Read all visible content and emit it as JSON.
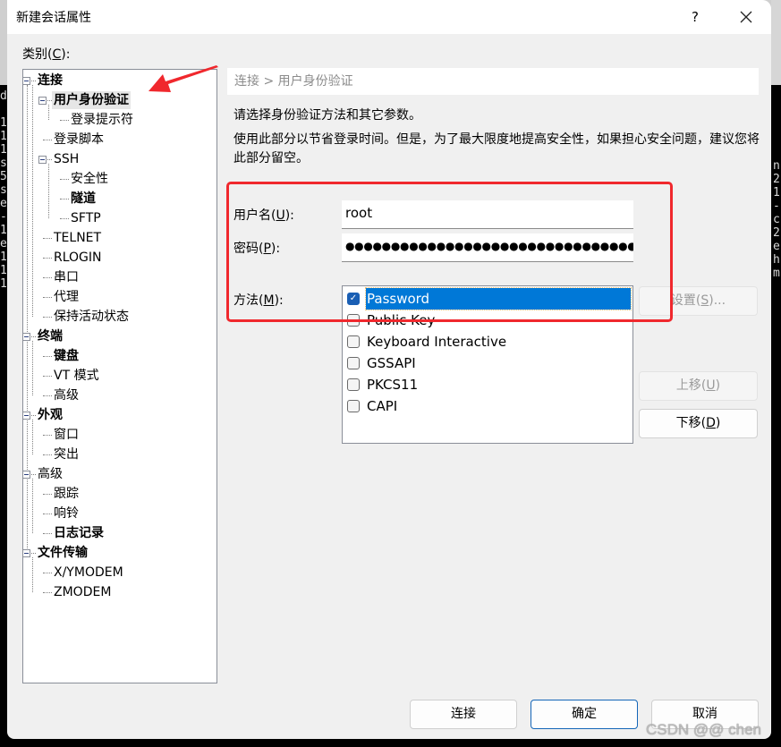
{
  "window": {
    "title": "新建会话属性",
    "help_label": "?",
    "close_label": "✕"
  },
  "background_terminal": {
    "left_chars": "d\n\n1\n1\n1\ns\n5\ns\ne\n-\n1\ne\n1\n1\n1",
    "right_chars": "n\n2\n1\n-\nc\n2\ne\nh\nm"
  },
  "category": {
    "label_prefix": "类别(",
    "label_accel": "C",
    "label_suffix": "):"
  },
  "tree": {
    "items": [
      {
        "label": "连接",
        "level": 0,
        "bold": true,
        "expandable": true
      },
      {
        "label": "用户身份验证",
        "level": 1,
        "bold": true,
        "expandable": true,
        "selected": true
      },
      {
        "label": "登录提示符",
        "level": 2
      },
      {
        "label": "登录脚本",
        "level": 1
      },
      {
        "label": "SSH",
        "level": 1,
        "expandable": true
      },
      {
        "label": "安全性",
        "level": 2
      },
      {
        "label": "隧道",
        "level": 2,
        "bold": true
      },
      {
        "label": "SFTP",
        "level": 2
      },
      {
        "label": "TELNET",
        "level": 1
      },
      {
        "label": "RLOGIN",
        "level": 1
      },
      {
        "label": "串口",
        "level": 1
      },
      {
        "label": "代理",
        "level": 1
      },
      {
        "label": "保持活动状态",
        "level": 1
      },
      {
        "label": "终端",
        "level": 0,
        "bold": true,
        "expandable": true
      },
      {
        "label": "键盘",
        "level": 1,
        "bold": true
      },
      {
        "label": "VT 模式",
        "level": 1
      },
      {
        "label": "高级",
        "level": 1
      },
      {
        "label": "外观",
        "level": 0,
        "bold": true,
        "expandable": true
      },
      {
        "label": "窗口",
        "level": 1
      },
      {
        "label": "突出",
        "level": 1
      },
      {
        "label": "高级",
        "level": 0,
        "expandable": true
      },
      {
        "label": "跟踪",
        "level": 1
      },
      {
        "label": "响铃",
        "level": 1
      },
      {
        "label": "日志记录",
        "level": 1,
        "bold": true
      },
      {
        "label": "文件传输",
        "level": 0,
        "bold": true,
        "expandable": true
      },
      {
        "label": "X/YMODEM",
        "level": 1
      },
      {
        "label": "ZMODEM",
        "level": 1
      }
    ]
  },
  "main": {
    "breadcrumb": "连接 > 用户身份验证",
    "description1": "请选择身份验证方法和其它参数。",
    "description2": "使用此部分以节省登录时间。但是，为了最大限度地提高安全性，如果担心安全问题，建议您将此部分留空。",
    "username": {
      "label_prefix": "用户名(",
      "accel": "U",
      "label_suffix": "):",
      "value": "root"
    },
    "password": {
      "label_prefix": "密码(",
      "accel": "P",
      "label_suffix": "):",
      "value": "●●●●●●●●●●●●●●●●●●●●●●●●●●●●●●●●●●"
    },
    "method": {
      "label_prefix": "方法(",
      "accel": "M",
      "label_suffix": "):"
    },
    "methods": [
      {
        "label": "Password",
        "checked": true,
        "selected": true
      },
      {
        "label": "Public Key",
        "checked": false
      },
      {
        "label": "Keyboard Interactive",
        "checked": false
      },
      {
        "label": "GSSAPI",
        "checked": false
      },
      {
        "label": "PKCS11",
        "checked": false
      },
      {
        "label": "CAPI",
        "checked": false
      }
    ],
    "settings_button": {
      "prefix": "设置(",
      "accel": "S",
      "suffix": ")...",
      "enabled": false
    },
    "move_up_button": {
      "prefix": "上移(",
      "accel": "U",
      "suffix": ")",
      "enabled": false
    },
    "move_down_button": {
      "prefix": "下移(",
      "accel": "D",
      "suffix": ")",
      "enabled": true
    }
  },
  "footer": {
    "connect_label": "连接",
    "ok_label": "确定",
    "cancel_label": "取消"
  },
  "annotation": {
    "color": "#f0282d"
  },
  "watermark": "CSDN @@ chen"
}
